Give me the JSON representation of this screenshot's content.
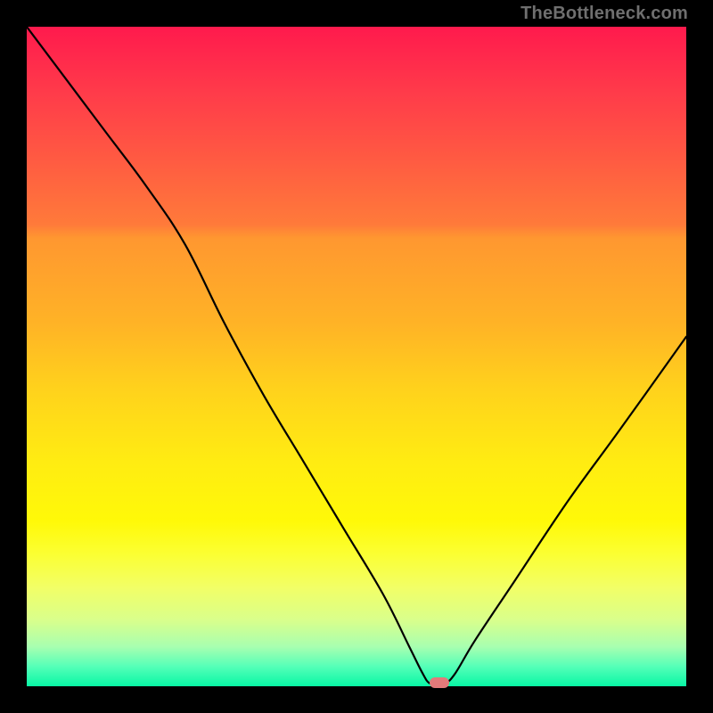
{
  "watermark": "TheBottleneck.com",
  "colors": {
    "frame": "#000000",
    "curve": "#000000",
    "marker": "#e37a7a",
    "watermark_text": "#6f6f6f"
  },
  "chart_data": {
    "type": "line",
    "title": "",
    "xlabel": "",
    "ylabel": "",
    "xlim": [
      0,
      100
    ],
    "ylim": [
      0,
      100
    ],
    "grid": false,
    "legend": false,
    "background_gradient": {
      "top": "#ff1a4d",
      "middle": "#ffec12",
      "bottom": "#08f7a5"
    },
    "series": [
      {
        "name": "bottleneck-curve",
        "x": [
          0,
          6,
          12,
          18,
          24,
          30,
          36,
          42,
          48,
          54,
          58,
          60,
          61,
          62,
          63.5,
          65,
          68,
          74,
          82,
          90,
          100
        ],
        "y": [
          100,
          92,
          84,
          76,
          67,
          55,
          44,
          34,
          24,
          14,
          6,
          2,
          0.5,
          0.5,
          0.5,
          2,
          7,
          16,
          28,
          39,
          53
        ]
      }
    ],
    "annotations": [
      {
        "name": "min-marker",
        "shape": "rounded-rect",
        "x": 62.5,
        "y": 0.5,
        "color": "#e37a7a"
      }
    ]
  }
}
